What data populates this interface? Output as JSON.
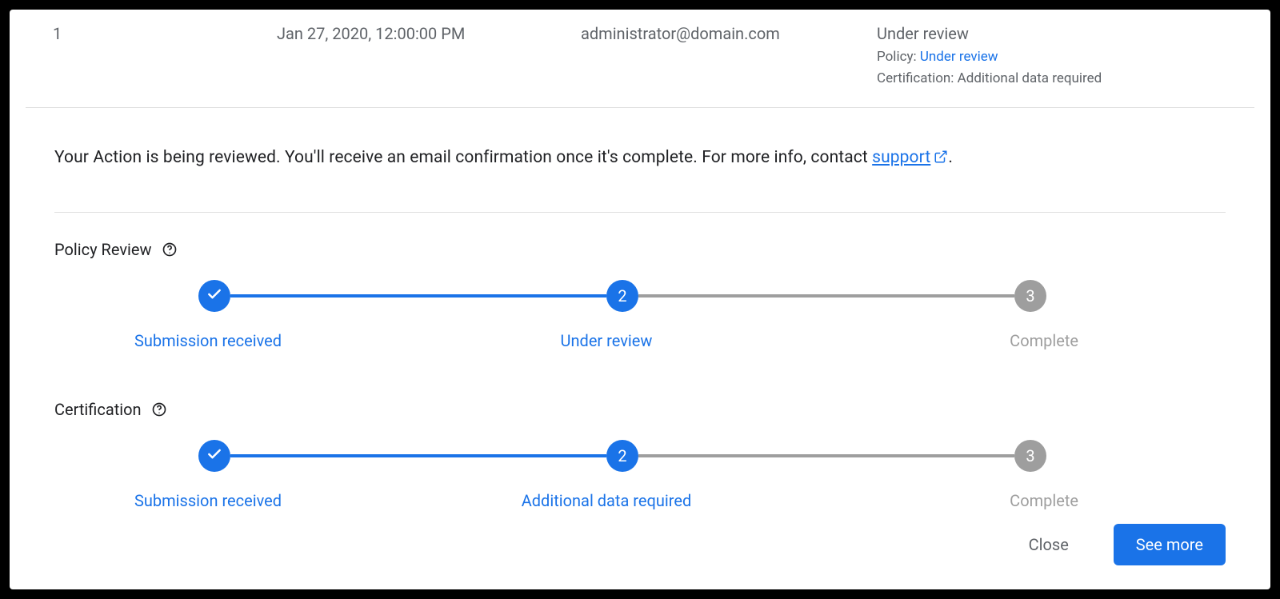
{
  "row": {
    "id": "1",
    "date": "Jan 27, 2020, 12:00:00 PM",
    "email": "administrator@domain.com",
    "status_headline": "Under review",
    "policy_label": "Policy: ",
    "policy_status": "Under review",
    "cert_label": "Certification: ",
    "cert_status": "Additional data required"
  },
  "info": {
    "text_before": "Your Action is being reviewed. You'll receive an email confirmation once it's complete. For more info, contact ",
    "link": "support",
    "text_after": "."
  },
  "policy_review": {
    "title": "Policy Review",
    "steps": {
      "s1": "Submission received",
      "s2": "Under review",
      "s3": "Complete"
    }
  },
  "certification": {
    "title": "Certification",
    "steps": {
      "s1": "Submission received",
      "s2": "Additional data required",
      "s3": "Complete"
    }
  },
  "buttons": {
    "close": "Close",
    "see_more": "See more"
  },
  "step_numbers": {
    "n2": "2",
    "n3": "3"
  }
}
